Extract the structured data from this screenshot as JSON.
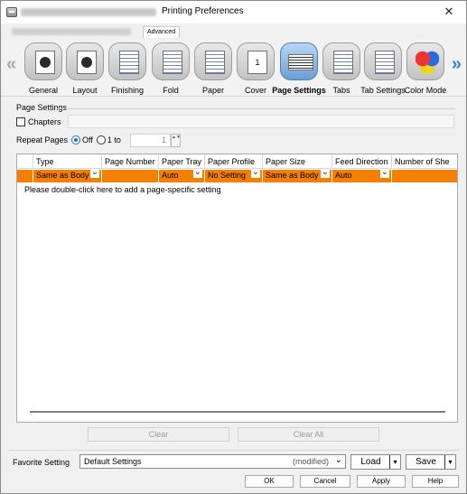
{
  "titlebar": {
    "title": "Printing Preferences",
    "close_glyph": "✕"
  },
  "tabs": {
    "advanced": "Advanced"
  },
  "toolbar": {
    "nav_left": "«",
    "nav_right": "»",
    "items": [
      {
        "label": "General",
        "icon": "general-icon"
      },
      {
        "label": "Layout",
        "icon": "layout-icon"
      },
      {
        "label": "Finishing",
        "icon": "finishing-icon"
      },
      {
        "label": "Fold",
        "icon": "fold-icon"
      },
      {
        "label": "Paper",
        "icon": "paper-icon"
      },
      {
        "label": "Cover",
        "icon": "cover-icon",
        "glyph": "1"
      },
      {
        "label": "Page Settings",
        "icon": "page-settings-icon",
        "active": true
      },
      {
        "label": "Tabs",
        "icon": "tabs-icon"
      },
      {
        "label": "Tab Settings",
        "icon": "tab-settings-icon"
      },
      {
        "label": "Color Mode",
        "icon": "color-mode-icon"
      }
    ]
  },
  "page_settings": {
    "section_title": "Page Settings",
    "chapters_label": "Chapters",
    "repeat_label": "Repeat Pages",
    "off_label": "Off",
    "one_to_label": "1 to",
    "spin_value": "1",
    "spin_glyphs": "▲▼",
    "table": {
      "columns": [
        "Type",
        "Page Number",
        "Paper Tray",
        "Paper Profile",
        "Paper Size",
        "Feed Direction",
        "Number of She"
      ],
      "row": [
        "Same as Body",
        "",
        "Auto",
        "No Setting",
        "Same as Body",
        "Auto",
        ""
      ],
      "hint": "Please double-click here to add a page-specific setting"
    },
    "clear_label": "Clear",
    "clear_all_label": "Clear All"
  },
  "favorite": {
    "label": "Favorite Setting",
    "value": "Default Settings",
    "modified": "(modified)",
    "caret": "⌄",
    "load_label": "Load",
    "save_label": "Save",
    "split_arrow": "▾"
  },
  "dialog_buttons": {
    "ok": "OK",
    "cancel": "Cancel",
    "apply": "Apply",
    "help": "Help"
  }
}
